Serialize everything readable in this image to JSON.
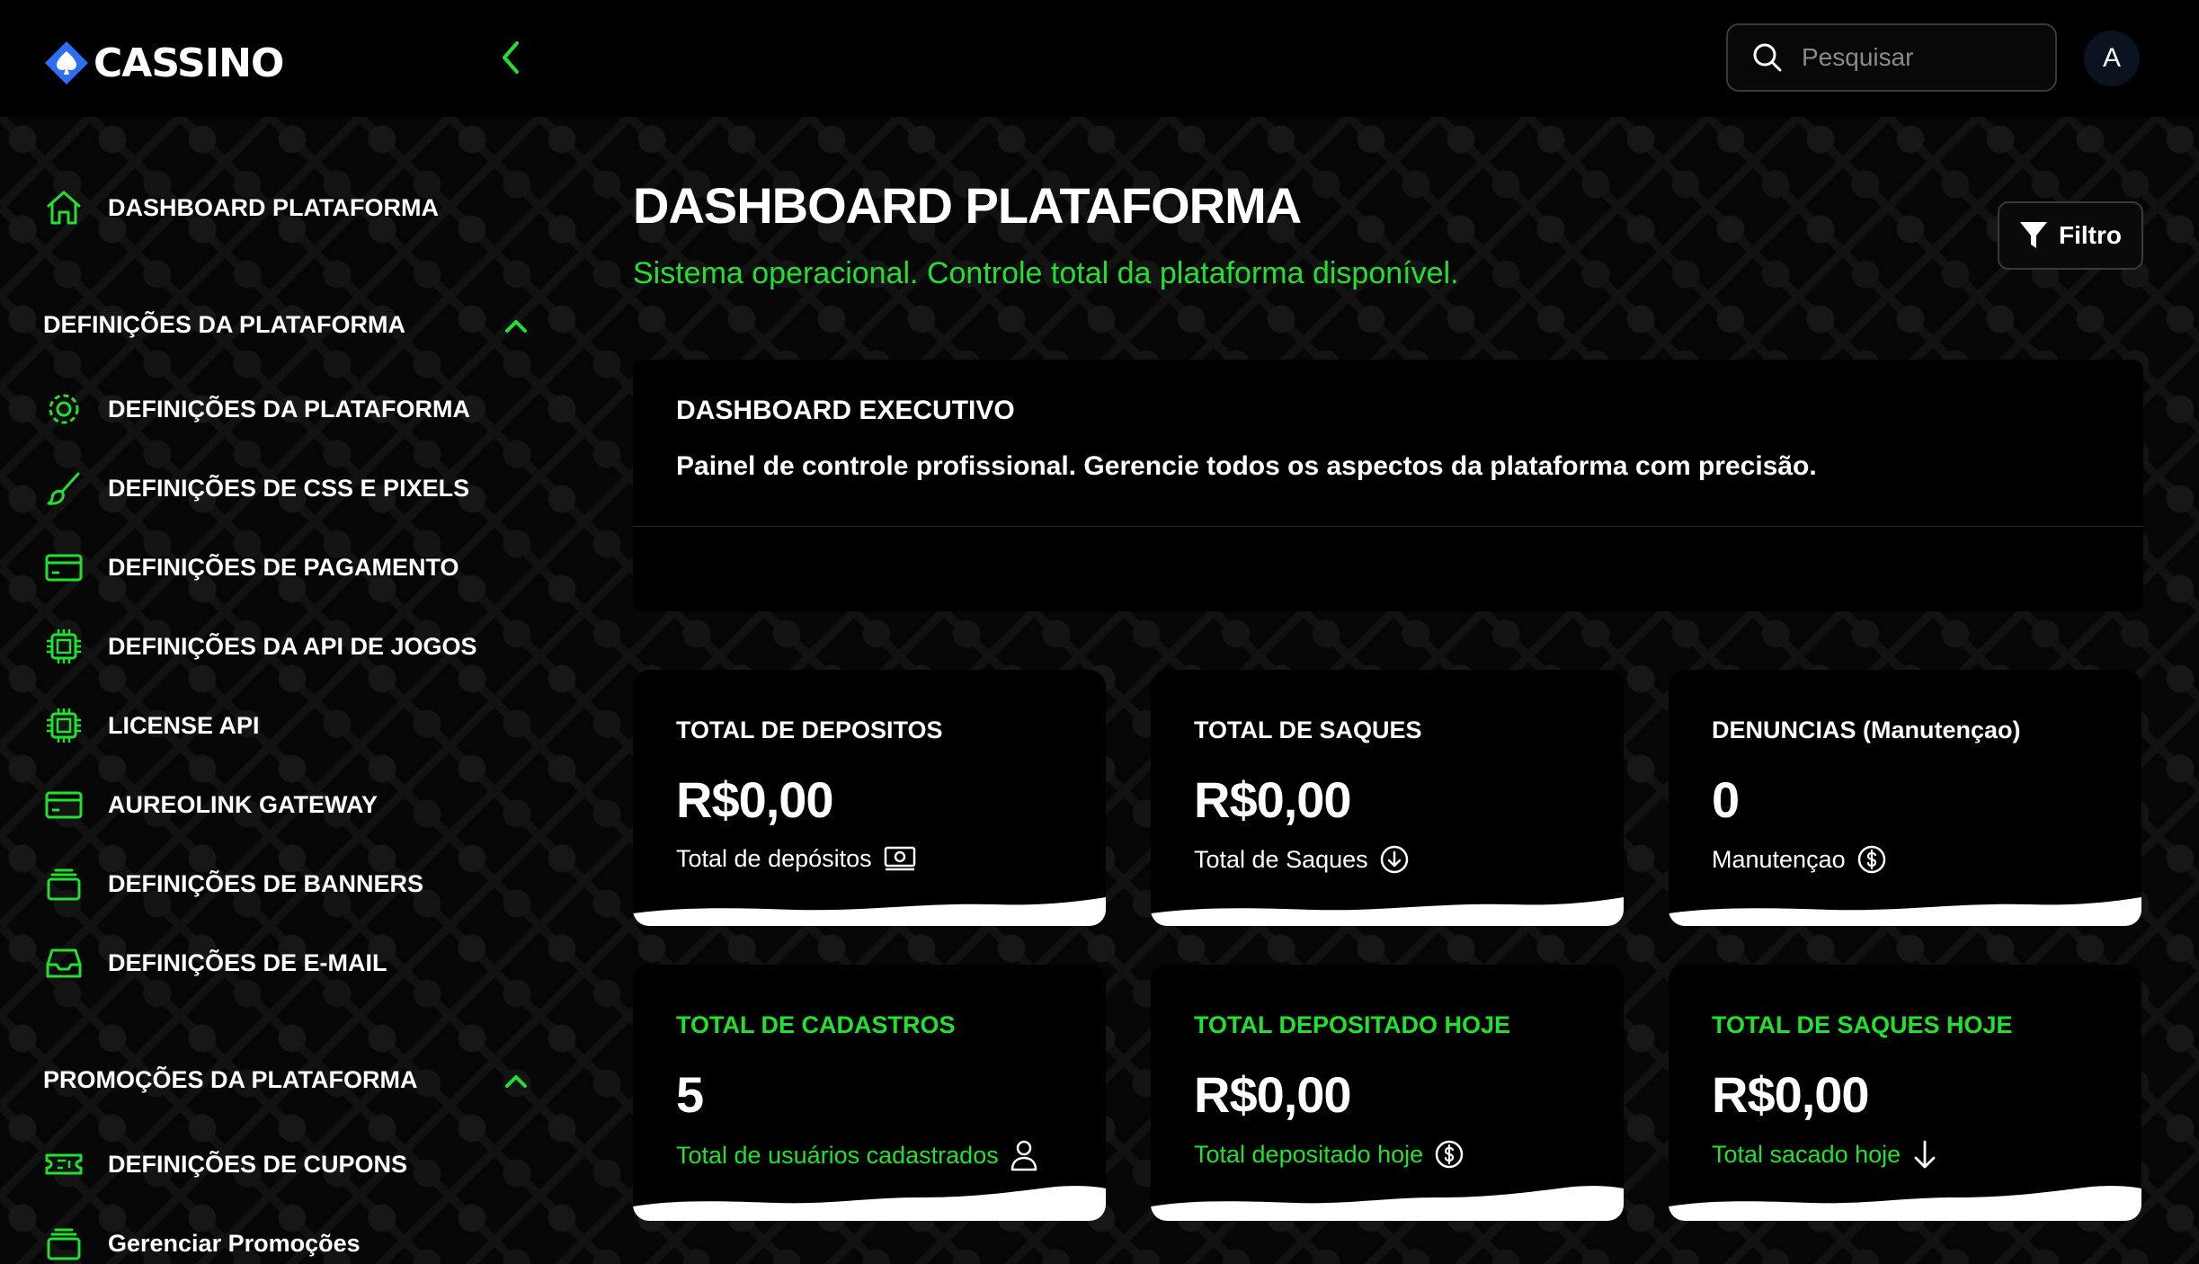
{
  "brand": {
    "logo_text": "CASSINO",
    "accent": "#22e12e",
    "logo_blue": "#2d6ef6"
  },
  "header": {
    "search_placeholder": "Pesquisar",
    "avatar_initial": "A"
  },
  "sidebar": {
    "dashboard": {
      "label": "DASHBOARD PLATAFORMA",
      "icon": "home-icon"
    },
    "sections": [
      {
        "label": "DEFINIÇÕES DA PLATAFORMA",
        "expanded": true,
        "items": [
          {
            "label": "DEFINIÇÕES DA PLATAFORMA",
            "icon": "gear-icon"
          },
          {
            "label": "DEFINIÇÕES DE CSS E PIXELS",
            "icon": "brush-icon"
          },
          {
            "label": "DEFINIÇÕES DE PAGAMENTO",
            "icon": "credit-card-icon"
          },
          {
            "label": "DEFINIÇÕES DA API DE JOGOS",
            "icon": "chip-icon"
          },
          {
            "label": "LICENSE API",
            "icon": "chip-icon"
          },
          {
            "label": "AUREOLINK GATEWAY",
            "icon": "credit-card-icon"
          },
          {
            "label": "DEFINIÇÕES DE BANNERS",
            "icon": "stack-icon"
          },
          {
            "label": "DEFINIÇÕES DE E-MAIL",
            "icon": "inbox-icon"
          }
        ]
      },
      {
        "label": "PROMOÇÕES DA PLATAFORMA",
        "expanded": true,
        "items": [
          {
            "label": "DEFINIÇÕES DE CUPONS",
            "icon": "ticket-icon"
          },
          {
            "label": "Gerenciar Promoções",
            "icon": "stack-icon"
          }
        ]
      }
    ]
  },
  "main": {
    "title": "DASHBOARD PLATAFORMA",
    "subtitle": "Sistema operacional. Controle total da plataforma disponível.",
    "filter_label": "Filtro",
    "executive": {
      "title": "DASHBOARD EXECUTIVO",
      "description": "Painel de controle profissional. Gerencie todos os aspectos da plataforma com precisão."
    },
    "cards": [
      {
        "title": "TOTAL DE DEPOSITOS",
        "value": "R$0,00",
        "subtitle": "Total de depósitos",
        "icon": "cash-icon",
        "accent": false
      },
      {
        "title": "TOTAL DE SAQUES",
        "value": "R$0,00",
        "subtitle": "Total de Saques",
        "icon": "arrow-down-circle-icon",
        "accent": false
      },
      {
        "title": "DENUNCIAS (Manutençao)",
        "value": "0",
        "subtitle": "Manutençao",
        "icon": "dollar-circle-icon",
        "accent": false
      },
      {
        "title": "TOTAL DE CADASTROS",
        "value": "5",
        "subtitle": "Total de usuários cadastrados",
        "icon": "user-icon",
        "accent": true
      },
      {
        "title": "TOTAL DEPOSITADO HOJE",
        "value": "R$0,00",
        "subtitle": "Total depositado hoje",
        "icon": "dollar-circle-icon",
        "accent": true
      },
      {
        "title": "TOTAL DE SAQUES HOJE",
        "value": "R$0,00",
        "subtitle": "Total sacado hoje",
        "icon": "arrow-down-icon",
        "accent": true
      }
    ]
  }
}
